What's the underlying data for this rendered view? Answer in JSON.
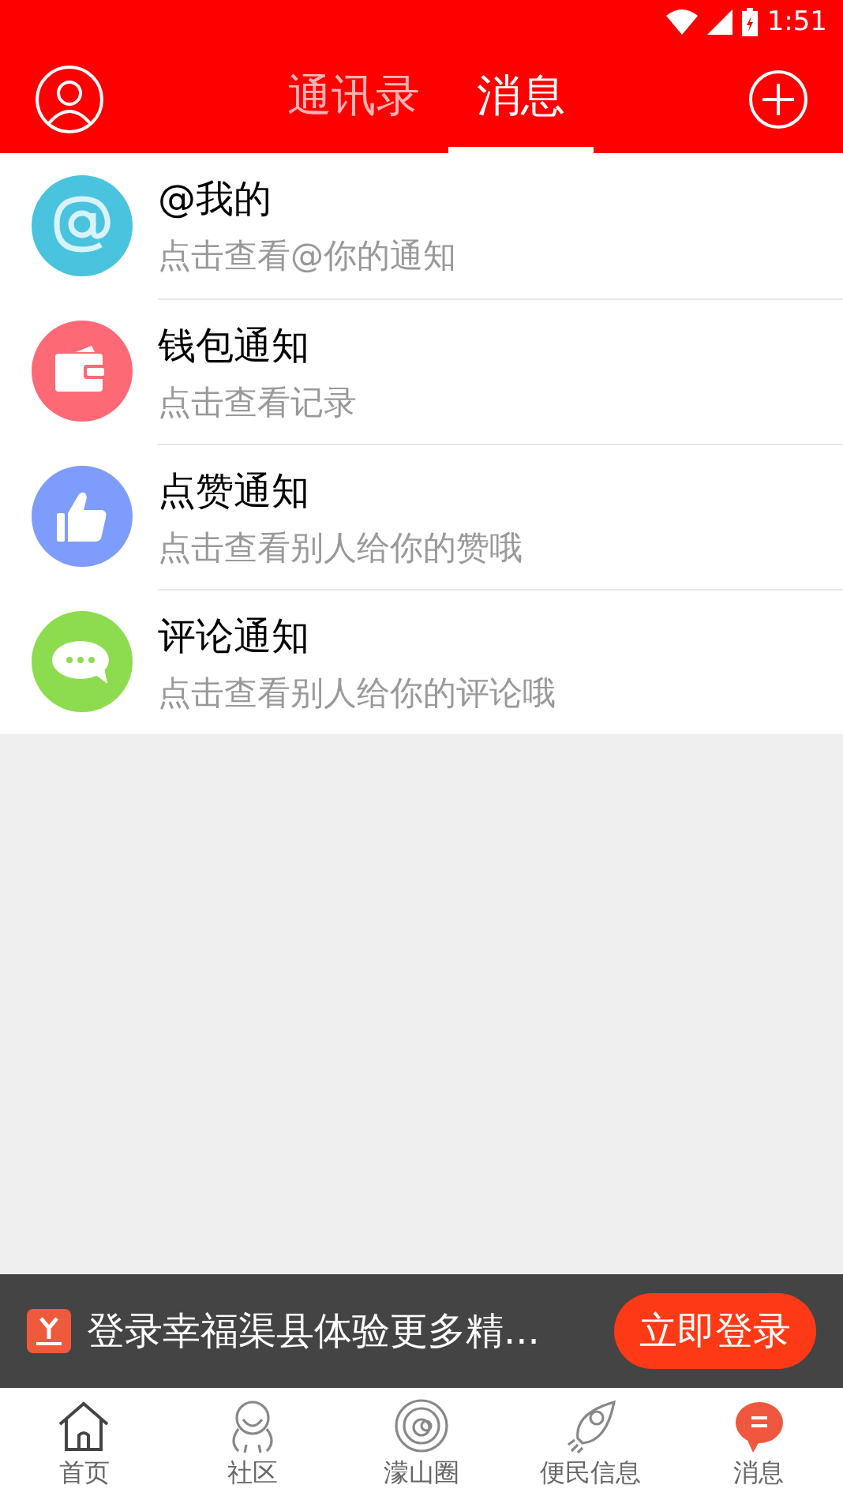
{
  "status_bar": {
    "time": "1:51"
  },
  "header": {
    "tabs": [
      {
        "label": "通讯录",
        "selected": false
      },
      {
        "label": "消息",
        "selected": true
      }
    ]
  },
  "notifications": [
    {
      "kind": "at",
      "color": "#4ac3df",
      "title": "@我的",
      "subtitle": "点击查看@你的通知"
    },
    {
      "kind": "wallet",
      "color": "#fd6a76",
      "title": "钱包通知",
      "subtitle": "点击查看记录"
    },
    {
      "kind": "like",
      "color": "#7e9cfb",
      "title": "点赞通知",
      "subtitle": "点击查看别人给你的赞哦"
    },
    {
      "kind": "comment",
      "color": "#8ddc4f",
      "title": "评论通知",
      "subtitle": "点击查看别人给你的评论哦"
    }
  ],
  "login_banner": {
    "text": "登录幸福渠县体验更多精...",
    "button": "立即登录"
  },
  "bottom_nav": [
    {
      "kind": "home",
      "label": "首页",
      "selected": false
    },
    {
      "kind": "community",
      "label": "社区",
      "selected": false
    },
    {
      "kind": "circle",
      "label": "濛山圈",
      "selected": false
    },
    {
      "kind": "rocket",
      "label": "便民信息",
      "selected": false
    },
    {
      "kind": "message",
      "label": "消息",
      "selected": true
    }
  ]
}
